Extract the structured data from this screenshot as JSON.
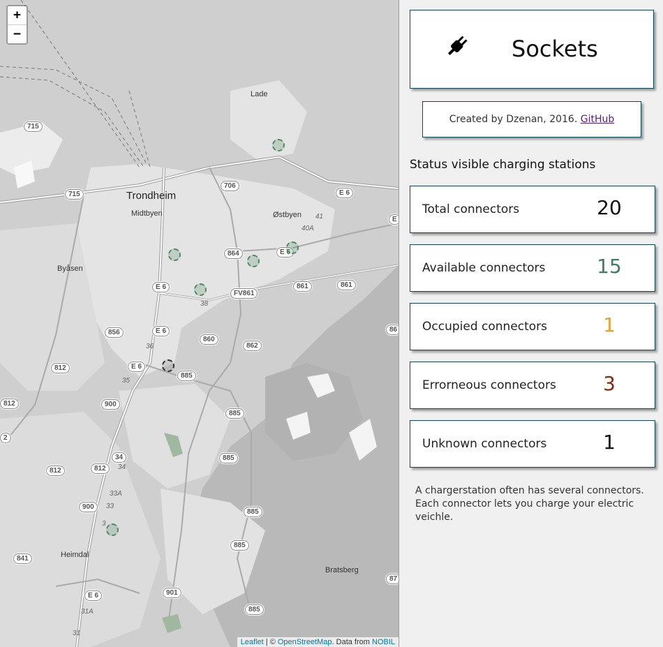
{
  "map": {
    "zoom_in": "+",
    "zoom_out": "−",
    "places": {
      "lade": "Lade",
      "trondheim": "Trondheim",
      "midtbyen": "Midtbyen",
      "ostbyen": "Østbyen",
      "byasen": "Byåsen",
      "heimdal": "Heimdal",
      "bratsberg": "Bratsberg"
    },
    "shields": [
      "715",
      "715",
      "706",
      "E 6",
      "E 6",
      "864",
      "E 6",
      "FV861",
      "861",
      "861",
      "E 6",
      "856",
      "860",
      "862",
      "E 6",
      "812",
      "885",
      "812",
      "900",
      "885",
      "2",
      "885",
      "34",
      "812",
      "812",
      "900",
      "885",
      "885",
      "841",
      "E 6",
      "901",
      "885",
      "87",
      "86",
      "E"
    ],
    "road_numbers": [
      "41",
      "40A",
      "38",
      "36",
      "35",
      "34",
      "33A",
      "33",
      "3",
      "31A",
      "31"
    ],
    "attribution": {
      "leaflet": "Leaflet",
      "sep": " | © ",
      "osm": "OpenStreetMap",
      "data_from": ". Data from ",
      "nobil": "NOBIL"
    },
    "marker_colors": {
      "available": "#4e8a63",
      "error": "#333333"
    }
  },
  "sidebar": {
    "title": "Sockets",
    "icon": "plug-icon",
    "credit_text": "Created by Dzenan, 2016. ",
    "credit_link": "GitHub",
    "status_heading": "Status visible charging stations",
    "stats": [
      {
        "label": "Total connectors",
        "value": "20",
        "color": "#111111"
      },
      {
        "label": "Available connectors",
        "value": "15",
        "color": "#3f7f5f"
      },
      {
        "label": "Occupied connectors",
        "value": "1",
        "color": "#f0a030"
      },
      {
        "label": "Errorneous connectors",
        "value": "3",
        "color": "#8a2a0a"
      },
      {
        "label": "Unknown connectors",
        "value": "1",
        "color": "#111111"
      }
    ],
    "note": "A chargerstation often has several connectors. Each connector lets you charge your electric veichle."
  }
}
